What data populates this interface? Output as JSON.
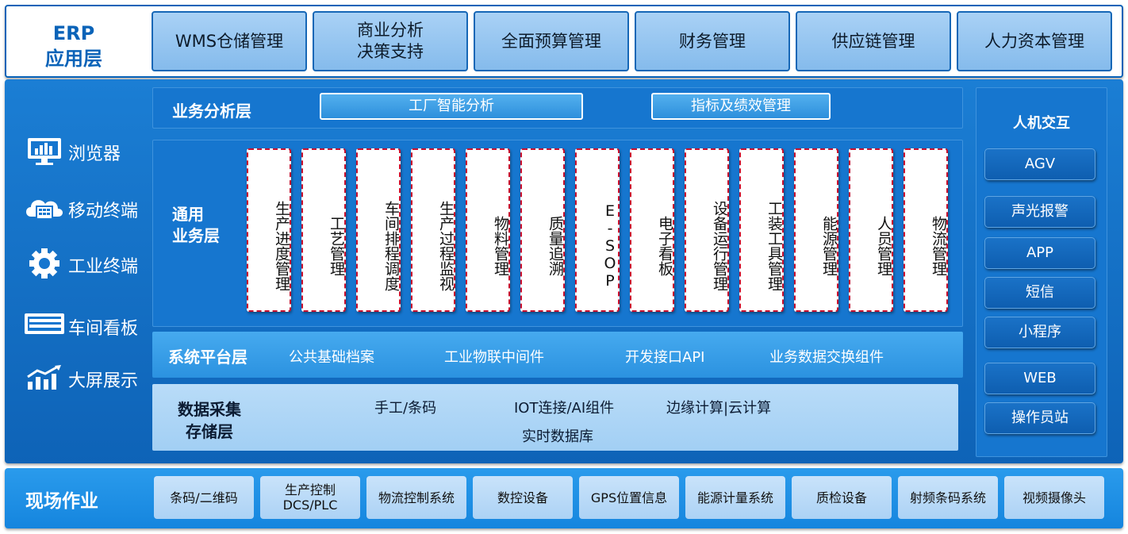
{
  "erp": {
    "title_line1": "ERP",
    "title_line2": "应用层",
    "modules": [
      {
        "line1": "WMS仓储管理",
        "line2": ""
      },
      {
        "line1": "商业分析",
        "line2": "决策支持"
      },
      {
        "line1": "全面预算管理",
        "line2": ""
      },
      {
        "line1": "财务管理",
        "line2": ""
      },
      {
        "line1": "供应链管理",
        "line2": ""
      },
      {
        "line1": "人力资本管理",
        "line2": ""
      }
    ]
  },
  "clients": [
    {
      "label": "浏览器",
      "icon": "monitor-icon"
    },
    {
      "label": "移动终端",
      "icon": "cloud-device-icon"
    },
    {
      "label": "工业终端",
      "icon": "gear-icon"
    },
    {
      "label": "车间看板",
      "icon": "board-icon"
    },
    {
      "label": "大屏展示",
      "icon": "chart-icon"
    }
  ],
  "analysis_layer": {
    "title": "业务分析层",
    "items": [
      "工厂智能分析",
      "指标及绩效管理"
    ]
  },
  "common_layer": {
    "title_line1": "通用",
    "title_line2": "业务层",
    "items": [
      "生产进度管理",
      "工艺管理",
      "车间排程调度",
      "生产过程监视",
      "物料管理",
      "质量追溯",
      "E-SOP",
      "电子看板",
      "设备运行管理",
      "工装工具管理",
      "能源管理",
      "人员管理",
      "物流管理"
    ]
  },
  "system_layer": {
    "title": "系统平台层",
    "items": [
      "公共基础档案",
      "工业物联中间件",
      "开发接口API",
      "业务数据交换组件"
    ]
  },
  "data_layer": {
    "title_line1": "数据采集",
    "title_line2": "存储层",
    "items": [
      "手工/条码",
      "IOT连接/AI组件",
      "边缘计算|云计算",
      "实时数据库"
    ]
  },
  "hmi": {
    "title": "人机交互",
    "items": [
      "AGV",
      "声光报警",
      "APP",
      "短信",
      "小程序",
      "WEB",
      "操作员站"
    ]
  },
  "field": {
    "title": "现场作业",
    "items": [
      {
        "line1": "条码/二维码",
        "line2": ""
      },
      {
        "line1": "生产控制",
        "line2": "DCS/PLC"
      },
      {
        "line1": "物流控制系统",
        "line2": ""
      },
      {
        "line1": "数控设备",
        "line2": ""
      },
      {
        "line1": "GPS位置信息",
        "line2": ""
      },
      {
        "line1": "能源计量系统",
        "line2": ""
      },
      {
        "line1": "质检设备",
        "line2": ""
      },
      {
        "line1": "射频条码系统",
        "line2": ""
      },
      {
        "line1": "视频摄像头",
        "line2": ""
      }
    ]
  },
  "colors": {
    "primary_blue": "#0e63b7",
    "card_border_red": "#c8102e",
    "light_blue": "#a9d1f5"
  }
}
